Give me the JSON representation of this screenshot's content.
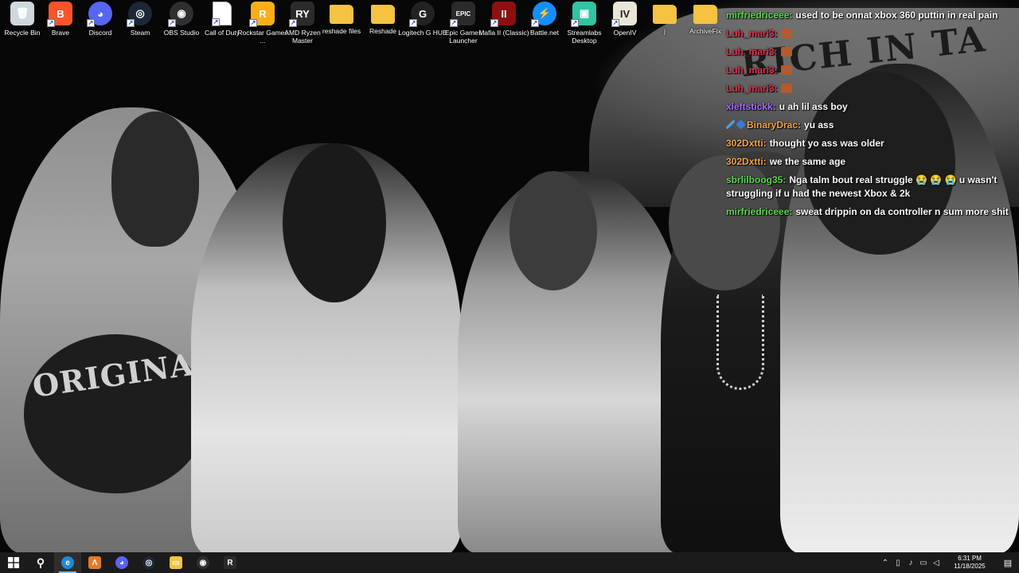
{
  "desktop": {
    "icons": [
      {
        "label": "Recycle Bin",
        "icon": "recycle-bin-icon",
        "color": "#cfd8dc",
        "text": "🗑"
      },
      {
        "label": "Brave",
        "icon": "brave-icon",
        "color": "#fb542b",
        "text": "B"
      },
      {
        "label": "Discord",
        "icon": "discord-icon",
        "color": "#5865f2",
        "text": "◕"
      },
      {
        "label": "Steam",
        "icon": "steam-icon",
        "color": "#1b2838",
        "text": "◎"
      },
      {
        "label": "OBS Studio",
        "icon": "obs-icon",
        "color": "#302e31",
        "text": "◉"
      },
      {
        "label": "Call of Duty",
        "icon": "file-icon",
        "color": "#ffffff",
        "text": ""
      },
      {
        "label": "Rockstar Games ...",
        "icon": "rockstar-icon",
        "color": "#fcaf17",
        "text": "R"
      },
      {
        "label": "AMD Ryzen Master",
        "icon": "amd-ryzen-icon",
        "color": "#2b2b2b",
        "text": "RY"
      },
      {
        "label": "reshade files",
        "icon": "folder-icon",
        "color": "#f5c242",
        "text": ""
      },
      {
        "label": "Reshade",
        "icon": "folder-icon",
        "color": "#f5c242",
        "text": ""
      },
      {
        "label": "Logitech G HUB",
        "icon": "logitech-icon",
        "color": "#222222",
        "text": "G"
      },
      {
        "label": "Epic Games Launcher",
        "icon": "epic-games-icon",
        "color": "#2a2a2a",
        "text": "EPIC"
      },
      {
        "label": "Mafia II (Classic)",
        "icon": "mafia-icon",
        "color": "#8c1010",
        "text": "II"
      },
      {
        "label": "Battle.net",
        "icon": "battlenet-icon",
        "color": "#148eff",
        "text": "⚡"
      },
      {
        "label": "Streamlabs Desktop",
        "icon": "streamlabs-icon",
        "color": "#31c3a2",
        "text": "▣"
      },
      {
        "label": "OpenIV",
        "icon": "openiv-icon",
        "color": "#e9e6d7",
        "text": "IV"
      },
      {
        "label": "j",
        "icon": "folder-icon",
        "color": "#f5c242",
        "text": ""
      },
      {
        "label": "ArchiveFix",
        "icon": "folder-icon",
        "color": "#f5c242",
        "text": ""
      }
    ]
  },
  "wallpaper": {
    "sign_text": "RICH IN TA",
    "shirt_text": "ORIGINALS"
  },
  "chat": {
    "colors": {
      "green": "#5bd84f",
      "red": "#e0304a",
      "purple": "#a86bff",
      "orange": "#f3a44a",
      "blue": "#9ec5ff"
    },
    "messages": [
      {
        "user": "mirfriedriceee:",
        "color": "#5bd84f",
        "text": "used to be onnat xbox 360 puttin in real pain",
        "badges": [],
        "emotes": 0
      },
      {
        "user": "Luh_mari3:",
        "color": "#e0304a",
        "text": "",
        "badges": [],
        "emotes": 1
      },
      {
        "user": "Luh_mari3:",
        "color": "#e0304a",
        "text": "",
        "badges": [],
        "emotes": 1
      },
      {
        "user": "Luh_mari3:",
        "color": "#e0304a",
        "text": "",
        "badges": [],
        "emotes": 1
      },
      {
        "user": "Luh_mari3:",
        "color": "#e0304a",
        "text": "",
        "badges": [],
        "emotes": 1
      },
      {
        "user": "xleftstickk:",
        "color": "#a86bff",
        "text": "u ah lil ass boy",
        "badges": [],
        "emotes": 0
      },
      {
        "user": "BinaryDrac:",
        "color": "#f3a44a",
        "text": "yu ass",
        "badges": [
          "sword",
          "cube"
        ],
        "emotes": 0
      },
      {
        "user": "302Dxtti:",
        "color": "#f3a44a",
        "text": "thought yo ass was older",
        "badges": [],
        "emotes": 0
      },
      {
        "user": "302Dxtti:",
        "color": "#f3a44a",
        "text": "we the same age",
        "badges": [],
        "emotes": 0
      },
      {
        "user": "sbrlilboog35:",
        "color": "#5bd84f",
        "text": "Nga talm bout real struggle 😭 😭 😭 u wasn't struggling if u had the newest Xbox & 2k",
        "badges": [],
        "emotes": 0
      },
      {
        "user": "mirfriedriceee:",
        "color": "#5bd84f",
        "text": "sweat drippin on da controller n sum more shit",
        "badges": [],
        "emotes": 0
      }
    ]
  },
  "taskbar": {
    "start_icon": "windows-start-icon",
    "pinned": [
      {
        "name": "search-icon",
        "color": "#1b1b1b",
        "text": "⚲",
        "active": false
      },
      {
        "name": "edge-icon",
        "color": "#1f8bd8",
        "text": "e",
        "active": true
      },
      {
        "name": "app-icon",
        "color": "#e07a2a",
        "text": "Λ",
        "active": false
      },
      {
        "name": "discord-icon",
        "color": "#5865f2",
        "text": "◕",
        "active": false
      },
      {
        "name": "steam-icon",
        "color": "#1b2838",
        "text": "◎",
        "active": false
      },
      {
        "name": "file-explorer-icon",
        "color": "#f5c242",
        "text": "▭",
        "active": false
      },
      {
        "name": "obs-icon",
        "color": "#302e31",
        "text": "◉",
        "active": false
      },
      {
        "name": "ryzen-master-icon",
        "color": "#2b2b2b",
        "text": "R",
        "active": false
      }
    ],
    "tray": [
      "chevron-up-icon",
      "battery-icon",
      "microphone-icon",
      "network-icon",
      "volume-icon"
    ],
    "time": "6:31 PM",
    "date": "11/18/2025"
  }
}
